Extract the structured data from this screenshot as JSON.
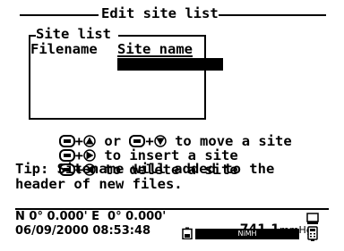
{
  "header": {
    "title": "Edit site list"
  },
  "site_list": {
    "legend": "Site list",
    "col_filename": "Filename",
    "col_sitename": "Site name",
    "site_name_value": ""
  },
  "help": {
    "move_or": "or",
    "move_text": "to move a site",
    "insert_text": "to insert a site",
    "delete_text": "to delete a site",
    "tip_line1": "Tip: Sitename will added to the",
    "tip_line2": "header of new files."
  },
  "status": {
    "position": "N 0° 0.000' E  0° 0.000'",
    "datetime": "06/09/2000 08:53:48",
    "pressure_value": "741.1",
    "pressure_unit": "mmHg",
    "battery_label": "NiMH"
  }
}
